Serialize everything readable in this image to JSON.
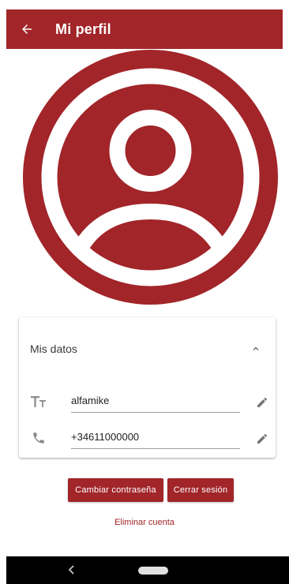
{
  "appbar": {
    "title": "Mi perfil",
    "back_icon": "arrow-left-icon",
    "background": "#a12529"
  },
  "avatar": {
    "icon": "account-circle-icon",
    "color": "#a12529"
  },
  "card": {
    "title": "Mis datos",
    "collapse_icon": "chevron-up-icon",
    "fields": [
      {
        "icon": "text-format-icon",
        "value": "alfamike",
        "edit_icon": "pencil-icon"
      },
      {
        "icon": "phone-icon",
        "value": "+34611000000",
        "edit_icon": "pencil-icon"
      }
    ]
  },
  "actions": {
    "change_password": "Cambiar contraseña",
    "logout": "Cerrar sesión",
    "delete_account": "Eliminar cuenta"
  },
  "navbar": {
    "back_icon": "nav-back-icon",
    "home_icon": "nav-home-pill"
  }
}
